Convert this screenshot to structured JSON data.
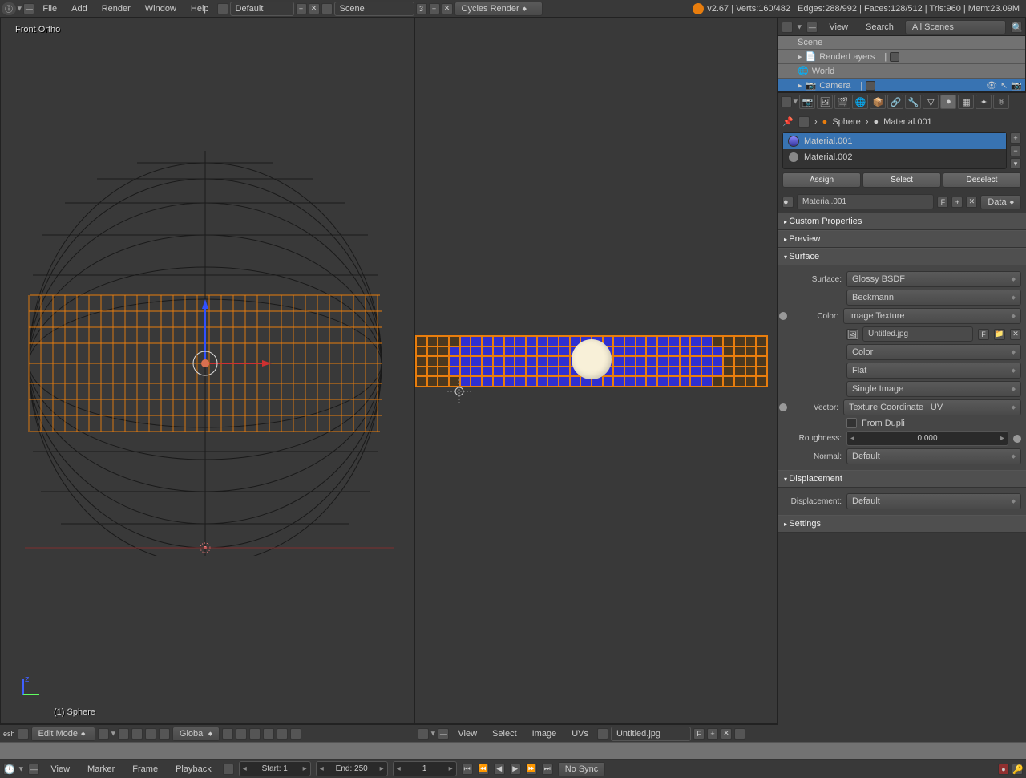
{
  "top": {
    "menus": [
      "File",
      "Add",
      "Render",
      "Window",
      "Help"
    ],
    "layout": "Default",
    "scene_label": "Scene",
    "scene_users": "3",
    "engine": "Cycles Render",
    "stats": "v2.67 | Verts:160/482 | Edges:288/992 | Faces:128/512 | Tris:960 | Mem:23.09M"
  },
  "outliner": {
    "hdr": {
      "view": "View",
      "search": "Search",
      "filter": "All Scenes"
    },
    "rows": [
      "Scene",
      "RenderLayers",
      "World",
      "Camera"
    ]
  },
  "breadcrumb": {
    "obj": "Sphere",
    "mat": "Material.001"
  },
  "materials": {
    "items": [
      "Material.001",
      "Material.002"
    ],
    "btns": [
      "Assign",
      "Select",
      "Deselect"
    ],
    "name": "Material.001",
    "f": "F",
    "link": "Data"
  },
  "panels": {
    "custom": "Custom Properties",
    "preview": "Preview",
    "surface": "Surface",
    "displacement": "Displacement",
    "settings": "Settings"
  },
  "surface": {
    "surface_lbl": "Surface:",
    "surface_val": "Glossy BSDF",
    "distribution": "Beckmann",
    "color_lbl": "Color:",
    "color_val": "Image Texture",
    "image_name": "Untitled.jpg",
    "img_f": "F",
    "colorspace": "Color",
    "projection": "Flat",
    "imgtype": "Single Image",
    "vector_lbl": "Vector:",
    "vector_val": "Texture Coordinate | UV",
    "from_dupli": "From Dupli",
    "roughness_lbl": "Roughness:",
    "roughness_val": "0.000",
    "normal_lbl": "Normal:",
    "normal_val": "Default"
  },
  "displacement": {
    "lbl": "Displacement:",
    "val": "Default"
  },
  "viewport": {
    "label": "Front Ortho",
    "object": "(1) Sphere",
    "mode": "Edit Mode",
    "orientation": "Global"
  },
  "uv": {
    "menus": [
      "View",
      "Select",
      "Image",
      "UVs"
    ],
    "image": "Untitled.jpg",
    "f": "F"
  },
  "timeline": {
    "menus": [
      "View",
      "Marker",
      "Frame",
      "Playback"
    ],
    "start": "Start: 1",
    "end": "End: 250",
    "current": "1",
    "sync": "No Sync"
  }
}
